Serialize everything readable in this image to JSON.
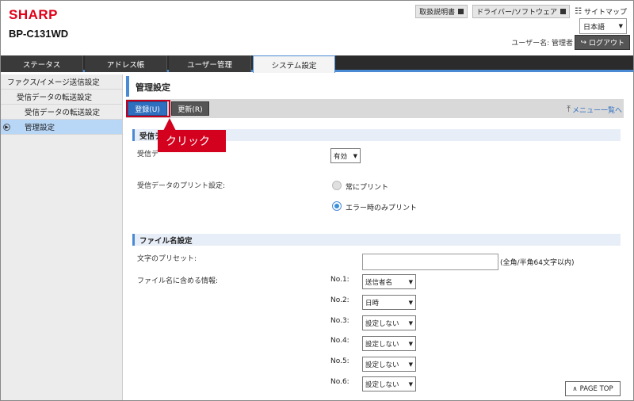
{
  "header": {
    "brand": "SHARP",
    "model": "BP-C131WD",
    "links": [
      "取扱説明書",
      "ドライバー/ソフトウェア"
    ],
    "sitemap": "サイトマップ",
    "language": "日本語",
    "user_label": "ユーザー名: 管理者",
    "logout": "ログアウト"
  },
  "tabs": [
    "ステータス",
    "アドレス帳",
    "ユーザー管理",
    "システム設定"
  ],
  "active_tab": "システム設定",
  "sidebar": {
    "items": [
      {
        "label": "ファクス/イメージ送信設定"
      },
      {
        "label": "受信データの転送設定"
      },
      {
        "label": "受信データの転送設定"
      },
      {
        "label": "管理設定"
      }
    ]
  },
  "main": {
    "title": "管理設定",
    "register_button": "登録(U)",
    "update_button": "更新(R)",
    "menu_list": "メニュー一覧へ",
    "callout": "クリック",
    "section1": "受信デ",
    "label_receive": "受信デ",
    "enabled_select": "有効",
    "print_label": "受信データのプリント設定:",
    "radio_always": "常にプリント",
    "radio_error": "エラー時のみプリント",
    "section2": "ファイル名設定",
    "preset_label": "文字のプリセット:",
    "preset_hint": "(全角/半角64文字以内)",
    "filename_label": "ファイル名に含める情報:",
    "filename_rows": [
      {
        "no": "No.1:",
        "value": "送信者名"
      },
      {
        "no": "No.2:",
        "value": "日時"
      },
      {
        "no": "No.3:",
        "value": "設定しない"
      },
      {
        "no": "No.4:",
        "value": "設定しない"
      },
      {
        "no": "No.5:",
        "value": "設定しない"
      },
      {
        "no": "No.6:",
        "value": "設定しない"
      }
    ],
    "page_top": "PAGE TOP"
  }
}
